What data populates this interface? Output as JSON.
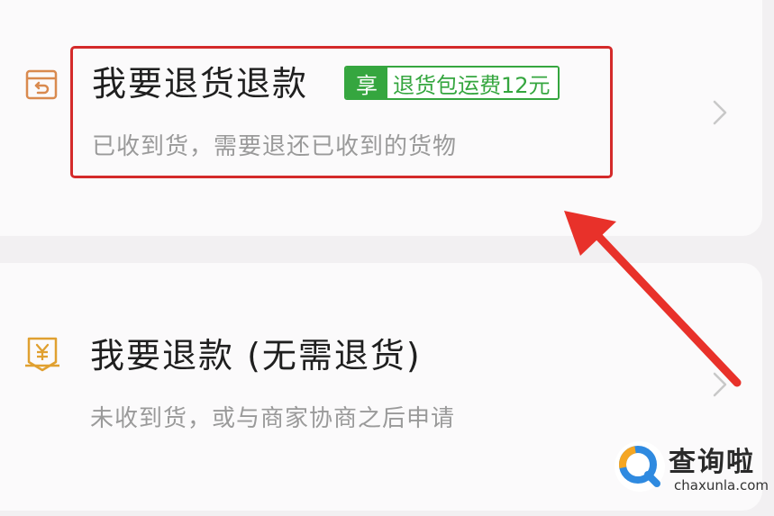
{
  "options": [
    {
      "icon": "return-box-icon",
      "title": "我要退货退款",
      "subtitle": "已收到货，需要退还已收到的货物",
      "badge": {
        "prefix": "享",
        "text": "退货包运费12元"
      }
    },
    {
      "icon": "yuan-receipt-icon",
      "title": "我要退款 (无需退货)",
      "subtitle": "未收到货，或与商家协商之后申请"
    }
  ],
  "watermark": {
    "name": "查询啦",
    "url": "chaxunla.com"
  },
  "colors": {
    "highlight": "#d42a2a",
    "badge_green": "#35a63f",
    "icon_orange": "#d98a4f",
    "icon_gold": "#e0a030"
  }
}
